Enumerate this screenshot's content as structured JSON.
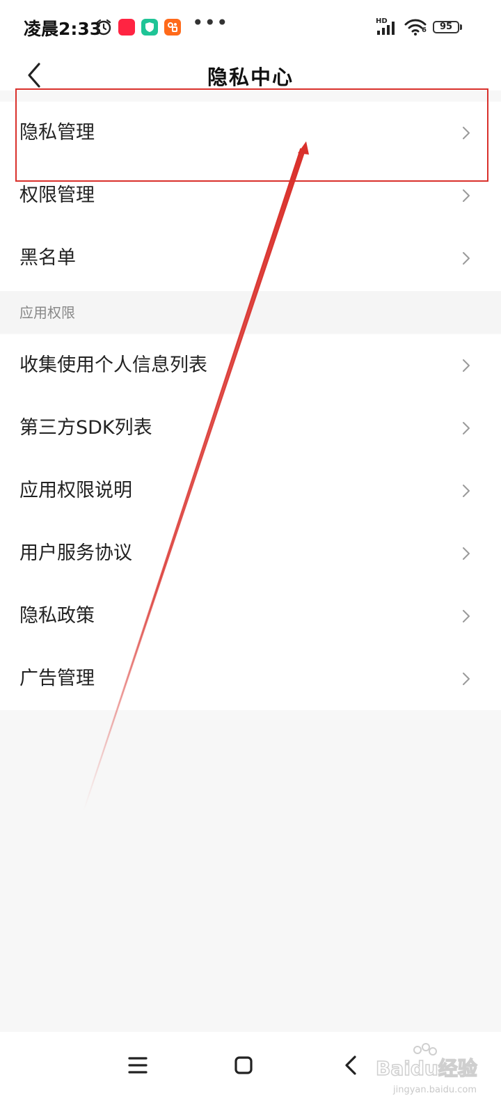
{
  "status_bar": {
    "time": "凌晨2:33",
    "battery_level": "95",
    "network_badge": "HD",
    "wifi_sub": "6",
    "icons": [
      "alarm-icon",
      "xiaohongshu-app-icon",
      "shield-app-icon",
      "orange-app-icon",
      "more-icon",
      "signal-icon",
      "wifi-icon",
      "battery-icon"
    ]
  },
  "header": {
    "title": "隐私中心",
    "back_icon": "chevron-left-icon"
  },
  "groups": {
    "top": {
      "items": [
        {
          "label": "隐私管理"
        },
        {
          "label": "权限管理"
        },
        {
          "label": "黑名单"
        }
      ]
    },
    "app_permissions": {
      "title": "应用权限",
      "items": [
        {
          "label": "收集使用个人信息列表"
        },
        {
          "label": "第三方SDK列表"
        },
        {
          "label": "应用权限说明"
        },
        {
          "label": "用户服务协议"
        },
        {
          "label": "隐私政策"
        },
        {
          "label": "广告管理"
        }
      ]
    }
  },
  "annotation": {
    "color": "#d9302b"
  },
  "nav_bar": {
    "icons": [
      "menu-icon",
      "home-icon",
      "back-icon"
    ]
  },
  "watermark": {
    "brand": "Baidu经验",
    "domain": "jingyan.baidu.com"
  }
}
